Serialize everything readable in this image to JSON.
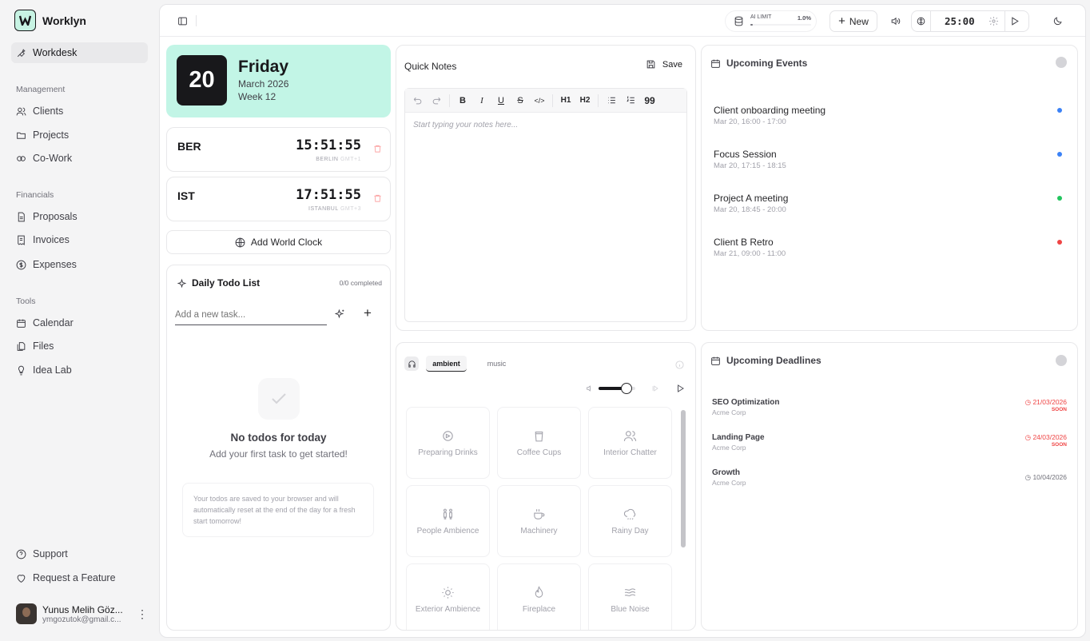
{
  "sidebar": {
    "brand": "Worklyn",
    "workdesk": "Workdesk",
    "sections": {
      "management": "Management",
      "financials": "Financials",
      "tools": "Tools"
    },
    "items": {
      "clients": "Clients",
      "projects": "Projects",
      "cowork": "Co-Work",
      "proposals": "Proposals",
      "invoices": "Invoices",
      "expenses": "Expenses",
      "calendar": "Calendar",
      "files": "Files",
      "idealab": "Idea Lab",
      "support": "Support",
      "request": "Request a Feature"
    },
    "user": {
      "name": "Yunus Melih Göz...",
      "email": "ymgozutok@gmail.c..."
    }
  },
  "topbar": {
    "ai_limit_label": "AI LIMIT",
    "ai_limit_value": "1.0%",
    "ai_limit_fraction": 0.01,
    "new_label": "New",
    "timer": "25:00"
  },
  "date": {
    "day_number": "20",
    "weekday": "Friday",
    "month_year": "March 2026",
    "week": "Week 12"
  },
  "clocks": [
    {
      "code": "BER",
      "time": "15:51:55",
      "city": "BERLIN",
      "tz": "GMT+1"
    },
    {
      "code": "IST",
      "time": "17:51:55",
      "city": "ISTANBUL",
      "tz": "GMT+3"
    }
  ],
  "add_clock_label": "Add World Clock",
  "todo": {
    "title": "Daily Todo List",
    "completed": "0/0 completed",
    "placeholder": "Add a new task...",
    "empty_title": "No todos for today",
    "empty_sub": "Add your first task to get started!",
    "note": "Your todos are saved to your browser and will automatically reset at the end of the day for a fresh start tomorrow!"
  },
  "notes": {
    "title": "Quick Notes",
    "save": "Save",
    "placeholder": "Start typing your notes here...",
    "tools": {
      "h1": "H1",
      "h2": "H2",
      "bold": "B",
      "italic": "I",
      "underline": "U",
      "strike": "S",
      "code": "</>",
      "quote": "99"
    }
  },
  "events": {
    "title": "Upcoming Events",
    "items": [
      {
        "title": "Client onboarding meeting",
        "time": "Mar 20, 16:00 - 17:00",
        "color": "#3b82f6"
      },
      {
        "title": "Focus Session",
        "time": "Mar 20, 17:15 - 18:15",
        "color": "#3b82f6"
      },
      {
        "title": "Project A meeting",
        "time": "Mar 20, 18:45 - 20:00",
        "color": "#22c55e"
      },
      {
        "title": "Client B Retro",
        "time": "Mar 21, 09:00 - 11:00",
        "color": "#ef4444"
      }
    ]
  },
  "sounds": {
    "tabs": {
      "ambient": "ambient",
      "music": "music"
    },
    "volume_fraction": 0.75,
    "items": [
      {
        "label": "Preparing Drinks",
        "icon": "drink-icon"
      },
      {
        "label": "Coffee Cups",
        "icon": "cup-icon"
      },
      {
        "label": "Interior Chatter",
        "icon": "people-icon"
      },
      {
        "label": "People Ambience",
        "icon": "persons-icon"
      },
      {
        "label": "Machinery",
        "icon": "coffee-machine-icon"
      },
      {
        "label": "Rainy Day",
        "icon": "rain-cloud-icon"
      },
      {
        "label": "Exterior Ambience",
        "icon": "sun-icon"
      },
      {
        "label": "Fireplace",
        "icon": "flame-icon"
      },
      {
        "label": "Blue Noise",
        "icon": "waves-icon"
      }
    ]
  },
  "deadlines": {
    "title": "Upcoming Deadlines",
    "items": [
      {
        "title": "SEO Optimization",
        "client": "Acme Corp",
        "date": "21/03/2026",
        "soon": "SOON",
        "color": "#ef4444"
      },
      {
        "title": "Landing Page",
        "client": "Acme Corp",
        "date": "24/03/2026",
        "soon": "SOON",
        "color": "#ef4444"
      },
      {
        "title": "Growth",
        "client": "Acme Corp",
        "date": "10/04/2026",
        "soon": "",
        "color": "#71717a"
      }
    ]
  }
}
